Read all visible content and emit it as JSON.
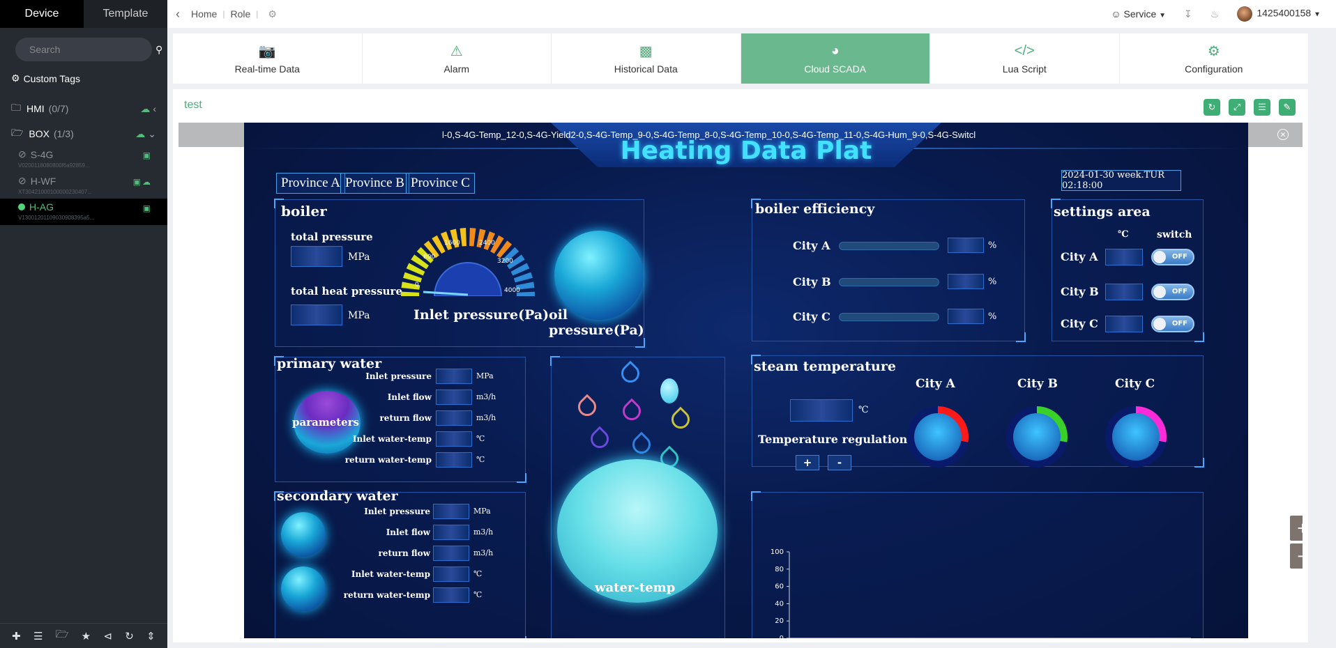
{
  "sidebar": {
    "tabs": [
      "Device",
      "Template"
    ],
    "search_placeholder": "Search",
    "custom_tags": "Custom Tags",
    "groups": [
      {
        "name": "HMI",
        "count": "(0/7)"
      },
      {
        "name": "BOX",
        "count": "(1/3)"
      }
    ],
    "devices": [
      {
        "name": "S-4G",
        "sn": "V0200118080800f6a92859..."
      },
      {
        "name": "H-WF",
        "sn": "XT30421000100000230407..."
      },
      {
        "name": "H-AG",
        "sn": "V13001201109030908395a5..."
      }
    ]
  },
  "topbar": {
    "crumbs": [
      "Home",
      "Role"
    ],
    "service": "Service",
    "user": "1425400158"
  },
  "nav_tabs": [
    {
      "label": "Real-time Data",
      "icon": "camera-icon"
    },
    {
      "label": "Alarm",
      "icon": "warning-icon"
    },
    {
      "label": "Historical Data",
      "icon": "bar-chart-icon"
    },
    {
      "label": "Cloud SCADA",
      "icon": "dashboard-icon"
    },
    {
      "label": "Lua Script",
      "icon": "code-icon"
    },
    {
      "label": "Configuration",
      "icon": "gear-icon"
    }
  ],
  "content": {
    "title": "test"
  },
  "scada": {
    "marquee": "l-0,S-4G-Temp_12-0,S-4G-Yield2-0,S-4G-Temp_9-0,S-4G-Temp_8-0,S-4G-Temp_10-0,S-4G-Temp_11-0,S-4G-Hum_9-0,S-4G-Switcl",
    "title": "Heating Data Plat",
    "provinces": [
      "Province A",
      "Province B",
      "Province C"
    ],
    "datetime": "2024-01-30  week.TUR  02:18:00",
    "boiler": {
      "title": "boiler",
      "total_pressure": "total pressure",
      "total_heat_pressure": "total heat pressure",
      "unit": "MPa",
      "inlet_pressure": "Inlet pressure(Pa)",
      "oil_pressure": "oil pressure(Pa)",
      "gauge_ticks": [
        "0",
        "800",
        "1600",
        "2400",
        "3200",
        "4000"
      ]
    },
    "efficiency": {
      "title": "boiler efficiency",
      "cities": [
        "City A",
        "City B",
        "City C"
      ],
      "unit": "%"
    },
    "settings": {
      "title": "settings area",
      "col_unit": "℃",
      "col_switch": "switch",
      "cities": [
        "City A",
        "City B",
        "City C"
      ],
      "toggle": "OFF"
    },
    "primary": {
      "title": "primary water",
      "badge": "parameters",
      "rows": [
        {
          "label": "Inlet pressure",
          "unit": "MPa"
        },
        {
          "label": "Inlet flow",
          "unit": "m3/h"
        },
        {
          "label": "return flow",
          "unit": "m3/h"
        },
        {
          "label": "Inlet water-temp",
          "unit": "℃"
        },
        {
          "label": "return water-temp",
          "unit": "℃"
        }
      ]
    },
    "secondary": {
      "title": "secondary water",
      "rows": [
        {
          "label": "Inlet pressure",
          "unit": "MPa"
        },
        {
          "label": "Inlet flow",
          "unit": "m3/h"
        },
        {
          "label": "return flow",
          "unit": "m3/h"
        },
        {
          "label": "Inlet water-temp",
          "unit": "℃"
        },
        {
          "label": "return water-temp",
          "unit": "℃"
        }
      ]
    },
    "water_temp": "water-temp",
    "steam": {
      "title": "steam temperature",
      "unit": "℃",
      "regulation": "Temperature regulation",
      "plus": "+",
      "minus": "-",
      "cities": [
        "City A",
        "City B",
        "City C"
      ],
      "ring_colors": [
        "#ff1a1a",
        "#39d02a",
        "#ff2ad8"
      ]
    },
    "chart_y_ticks": [
      "100",
      "80",
      "60",
      "40",
      "20",
      "0"
    ]
  }
}
